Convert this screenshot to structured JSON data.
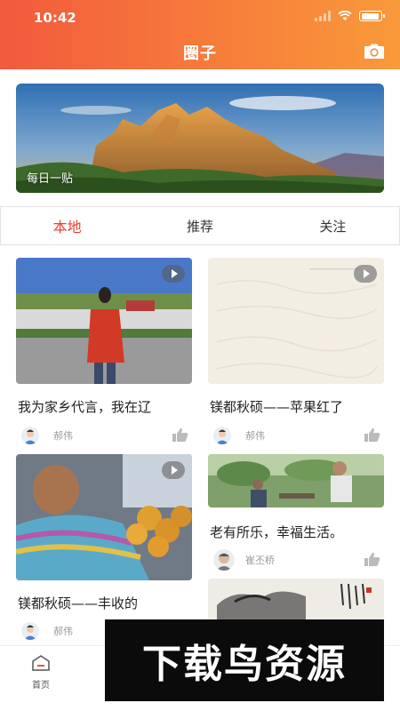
{
  "status_bar": {
    "time": "10:42"
  },
  "header": {
    "title": "圈子",
    "camera_icon": "camera-icon"
  },
  "banner": {
    "caption": "每日一贴"
  },
  "tabs": [
    {
      "label": "本地",
      "active": true
    },
    {
      "label": "推荐",
      "active": false
    },
    {
      "label": "关注",
      "active": false
    }
  ],
  "feed": [
    {
      "title": "我为家乡代言，我在辽",
      "author": "郝伟",
      "has_video": true
    },
    {
      "title": "镁都秋硕——苹果红了",
      "author": "郝伟",
      "has_video": true
    },
    {
      "title": "镁都秋硕——丰收的",
      "author": "郝伟",
      "has_video": true
    },
    {
      "title": "老有所乐，幸福生活。",
      "author": "崔丕桥",
      "has_video": false
    },
    {
      "title": "",
      "author": "",
      "has_video": false
    }
  ],
  "bottom_nav": {
    "home_label": "首页"
  },
  "watermark": {
    "text": "下载鸟资源"
  },
  "colors": {
    "accent": "#e8402f",
    "header_start": "#f25a3d",
    "header_end": "#f99a3a"
  }
}
